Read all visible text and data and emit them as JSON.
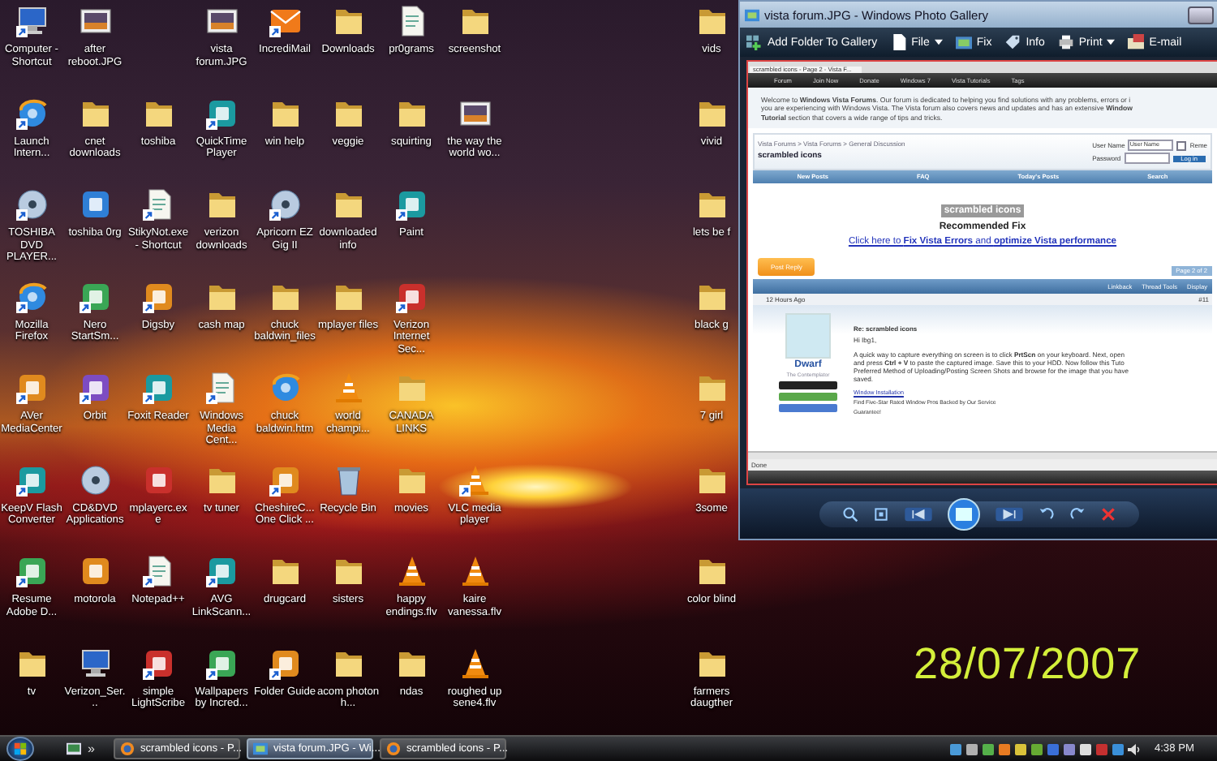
{
  "desktop_icons": [
    {
      "label": "Computer - Shortcut",
      "kind": "computer",
      "shortcut": true
    },
    {
      "label": "after reboot.JPG",
      "kind": "picture",
      "shortcut": false
    },
    {
      "label": "vista forum.JPG",
      "kind": "picture",
      "shortcut": false
    },
    {
      "label": "IncrediMail",
      "kind": "envelope",
      "shortcut": true
    },
    {
      "label": "Downloads",
      "kind": "folder",
      "shortcut": false
    },
    {
      "label": "pr0grams",
      "kind": "document",
      "shortcut": false
    },
    {
      "label": "screenshot",
      "kind": "folder",
      "shortcut": false
    },
    {
      "label": "vids",
      "kind": "folder",
      "shortcut": false
    },
    {
      "label": "Launch Intern...",
      "kind": "globe",
      "shortcut": true
    },
    {
      "label": "cnet downloads",
      "kind": "folder",
      "shortcut": false
    },
    {
      "label": "toshiba",
      "kind": "folder",
      "shortcut": false
    },
    {
      "label": "QuickTime Player",
      "kind": "app",
      "shortcut": true
    },
    {
      "label": "win help",
      "kind": "folder",
      "shortcut": false
    },
    {
      "label": "veggie",
      "kind": "folder",
      "shortcut": false
    },
    {
      "label": "squirting",
      "kind": "folder",
      "shortcut": false
    },
    {
      "label": "the way the world wo...",
      "kind": "picture",
      "shortcut": false
    },
    {
      "label": "vivid",
      "kind": "folder",
      "shortcut": false
    },
    {
      "label": "TOSHIBA DVD PLAYER...",
      "kind": "disc",
      "shortcut": true
    },
    {
      "label": "toshiba 0rg",
      "kind": "app",
      "shortcut": false
    },
    {
      "label": "StikyNot.exe - Shortcut",
      "kind": "document",
      "shortcut": true
    },
    {
      "label": "verizon downloads",
      "kind": "folder",
      "shortcut": false
    },
    {
      "label": "Apricorn EZ Gig II",
      "kind": "disc",
      "shortcut": true
    },
    {
      "label": "downloaded info",
      "kind": "folder",
      "shortcut": false
    },
    {
      "label": "Paint",
      "kind": "app",
      "shortcut": true
    },
    {
      "label": "lets be f",
      "kind": "folder",
      "shortcut": false
    },
    {
      "label": "Mozilla Firefox",
      "kind": "globe",
      "shortcut": true
    },
    {
      "label": "Nero StartSm...",
      "kind": "app",
      "shortcut": true
    },
    {
      "label": "Digsby",
      "kind": "app",
      "shortcut": true
    },
    {
      "label": "cash map",
      "kind": "folder",
      "shortcut": false
    },
    {
      "label": "chuck baldwin_files",
      "kind": "folder",
      "shortcut": false
    },
    {
      "label": "mplayer files",
      "kind": "folder",
      "shortcut": false
    },
    {
      "label": "Verizon Internet Sec...",
      "kind": "app",
      "shortcut": true
    },
    {
      "label": "black g",
      "kind": "folder",
      "shortcut": false
    },
    {
      "label": "AVer MediaCenter",
      "kind": "app",
      "shortcut": true
    },
    {
      "label": "Orbit",
      "kind": "app",
      "shortcut": true
    },
    {
      "label": "Foxit Reader",
      "kind": "app",
      "shortcut": true
    },
    {
      "label": "Windows Media Cent...",
      "kind": "document",
      "shortcut": true
    },
    {
      "label": "chuck baldwin.htm",
      "kind": "globe",
      "shortcut": false
    },
    {
      "label": "world champi...",
      "kind": "cone",
      "shortcut": false
    },
    {
      "label": "CANADA LINKS",
      "kind": "folder",
      "shortcut": false
    },
    {
      "label": "7 girl",
      "kind": "folder",
      "shortcut": false
    },
    {
      "label": "KeepV Flash Converter",
      "kind": "app",
      "shortcut": true
    },
    {
      "label": "CD&DVD Applications",
      "kind": "disc",
      "shortcut": false
    },
    {
      "label": "mplayerc.exe",
      "kind": "app",
      "shortcut": false
    },
    {
      "label": "tv tuner",
      "kind": "folder",
      "shortcut": false
    },
    {
      "label": "CheshireC... One Click ...",
      "kind": "app",
      "shortcut": true
    },
    {
      "label": "Recycle Bin",
      "kind": "bin",
      "shortcut": false
    },
    {
      "label": "movies",
      "kind": "folder",
      "shortcut": false
    },
    {
      "label": "VLC media player",
      "kind": "cone",
      "shortcut": true
    },
    {
      "label": "3some",
      "kind": "folder",
      "shortcut": false
    },
    {
      "label": "Resume Adobe D...",
      "kind": "app",
      "shortcut": true
    },
    {
      "label": "motorola",
      "kind": "app",
      "shortcut": false
    },
    {
      "label": "Notepad++",
      "kind": "document",
      "shortcut": true
    },
    {
      "label": "AVG LinkScann...",
      "kind": "app",
      "shortcut": true
    },
    {
      "label": "drugcard",
      "kind": "folder",
      "shortcut": false
    },
    {
      "label": "sisters",
      "kind": "folder",
      "shortcut": false
    },
    {
      "label": "happy endings.flv",
      "kind": "cone",
      "shortcut": false
    },
    {
      "label": "kaire vanessa.flv",
      "kind": "cone",
      "shortcut": false
    },
    {
      "label": "color blind",
      "kind": "folder",
      "shortcut": false
    },
    {
      "label": "tv",
      "kind": "folder",
      "shortcut": false
    },
    {
      "label": "Verizon_Ser...",
      "kind": "computer",
      "shortcut": false
    },
    {
      "label": "simple LightScribe",
      "kind": "app",
      "shortcut": true
    },
    {
      "label": "Wallpapers by Incred...",
      "kind": "app",
      "shortcut": true
    },
    {
      "label": "Folder Guide",
      "kind": "app",
      "shortcut": true
    },
    {
      "label": "acom photon h...",
      "kind": "folder",
      "shortcut": false
    },
    {
      "label": "ndas",
      "kind": "folder",
      "shortcut": false
    },
    {
      "label": "roughed up sene4.flv",
      "kind": "cone",
      "shortcut": false
    },
    {
      "label": "farmers daugther",
      "kind": "folder",
      "shortcut": false
    }
  ],
  "date_stamp": "28/07/2007",
  "photo_gallery": {
    "title": "vista forum.JPG - Windows Photo Gallery",
    "toolbar": [
      {
        "label": "Add Folder To Gallery",
        "kind": "gallery",
        "menu": false
      },
      {
        "label": "File",
        "kind": "file",
        "menu": true
      },
      {
        "label": "Fix",
        "kind": "fix",
        "menu": false
      },
      {
        "label": "Info",
        "kind": "info",
        "menu": false
      },
      {
        "label": "Print",
        "kind": "print",
        "menu": true
      },
      {
        "label": "E-mail",
        "kind": "email",
        "menu": false
      }
    ],
    "photo": {
      "browser_tab": "scrambled icons - Page 2 - Vista F...",
      "nav": [
        "Forum",
        "Join Now",
        "Donate",
        "Windows 7",
        "Vista Tutorials",
        "Tags"
      ],
      "welcome_lines": [
        "Welcome to **Windows Vista Forums**. Our forum is dedicated to helping you find solutions with any problems, errors or i",
        "you are experiencing with Windows Vista. The Vista forum also covers news and updates and has an extensive **Window**",
        "**Tutorial** section that covers a wide range of tips and tricks."
      ],
      "breadcrumb": "Vista Forums > Vista Forums > General Discussion",
      "thread_title": "scrambled icons",
      "login": {
        "user_label": "User Name",
        "user_value": "User Name",
        "password_label": "Password",
        "remember": "Reme",
        "remember_checked": false,
        "button": "Log in"
      },
      "navbar": [
        "New Posts",
        "FAQ",
        "Today's Posts",
        "Search"
      ],
      "heading": "scrambled icons",
      "fix_title": "Recommended Fix",
      "fix_link": "Click here to **Fix Vista Errors** and **optimize Vista performance**",
      "post_reply": "Post Reply",
      "page_label": "Page 2 of 2",
      "thread_tools": [
        "Linkback",
        "Thread Tools",
        "Display"
      ],
      "post_time": "12 Hours Ago",
      "post_number": "#11",
      "author": "Dwarf",
      "author_title": "The Contemplator",
      "post_title": "Re: scrambled icons",
      "greeting": "Hi Ibg1,",
      "body_lines": [
        "A quick way to capture everything on screen is to click **PrtScn** on your keyboard. Next, open",
        "and press **Ctrl + V** to paste the captured image. Save this to your HDD. Now follow this Tuto",
        "Preferred Method of Uploading/Posting Screen Shots and browse for the image that you have",
        "saved."
      ],
      "ad_link": "Window Installation",
      "ad_text": "Find Five-Star Rated Window Pros Backed by Our Service",
      "ad_guarantee": "Guarantee!",
      "status": "Done"
    }
  },
  "taskbar": {
    "quick_launch_more": "»",
    "tasks": [
      {
        "label": "scrambled icons - P...",
        "kind": "browser",
        "selected": false
      },
      {
        "label": "vista forum.JPG - Wi...",
        "kind": "gallery",
        "selected": true
      },
      {
        "label": "scrambled icons - P...",
        "kind": "browser",
        "selected": false
      }
    ],
    "clock": "4:38 PM"
  }
}
